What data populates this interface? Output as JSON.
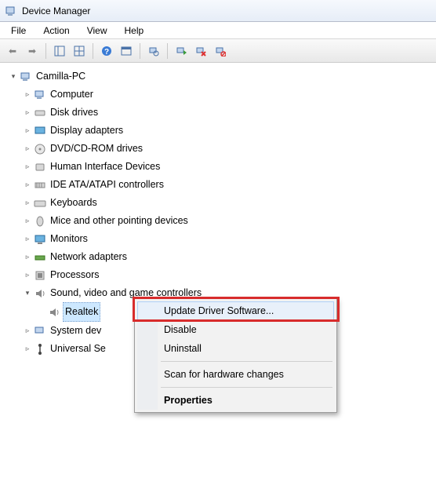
{
  "window": {
    "title": "Device Manager"
  },
  "menubar": [
    "File",
    "Action",
    "View",
    "Help"
  ],
  "tree": {
    "root": "Camilla-PC",
    "children": [
      "Computer",
      "Disk drives",
      "Display adapters",
      "DVD/CD-ROM drives",
      "Human Interface Devices",
      "IDE ATA/ATAPI controllers",
      "Keyboards",
      "Mice and other pointing devices",
      "Monitors",
      "Network adapters",
      "Processors"
    ],
    "expanded": {
      "label": "Sound, video and game controllers",
      "child": "Realtek"
    },
    "rest": [
      "System dev",
      "Universal Se"
    ]
  },
  "context_menu": {
    "update": "Update Driver Software...",
    "disable": "Disable",
    "uninstall": "Uninstall",
    "scan": "Scan for hardware changes",
    "properties": "Properties"
  }
}
